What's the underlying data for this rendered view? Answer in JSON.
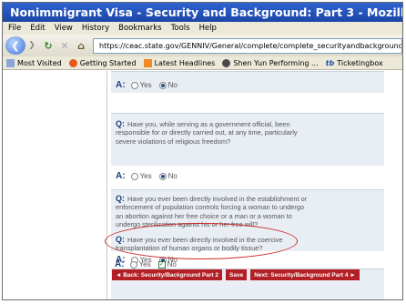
{
  "window": {
    "title": "Nonimmigrant Visa - Security and Background: Part 3 - Mozilla Firefox"
  },
  "menu": [
    "File",
    "Edit",
    "View",
    "History",
    "Bookmarks",
    "Tools",
    "Help"
  ],
  "nav": {
    "url": "https://ceac.state.gov/GENNIV/General/complete/complete_securityandbackground3.aspx"
  },
  "bookmarks": [
    "Most Visited",
    "Getting Started",
    "Latest Headlines",
    "Shen Yun Performing ...",
    "Ticketingbox"
  ],
  "form": {
    "q_label": "Q:",
    "a_label": "A:",
    "yes": "Yes",
    "no": "No",
    "questions": [
      {
        "text": "Have you, while serving as a government official, been responsible for or directly carried out, at any time, particularly severe violations of religious freedom?"
      },
      {
        "text": "Have you ever been directly involved in the establishment or enforcement of population controls forcing a woman to undergo an abortion against her free choice or a man or a woman to undergo sterilization against his or her free will?"
      },
      {
        "text": "Have you ever been directly involved in the coercive transplantation of human organs or bodily tissue?"
      }
    ]
  },
  "buttons": {
    "back": "◄ Back: Security/Background Part 2",
    "save": "Save",
    "next": "Next: Security/Background Part 4 ►"
  },
  "colors": {
    "titlebar": "#2356c0",
    "accent_red": "#b21f24",
    "highlight": "#cc2a2a"
  }
}
